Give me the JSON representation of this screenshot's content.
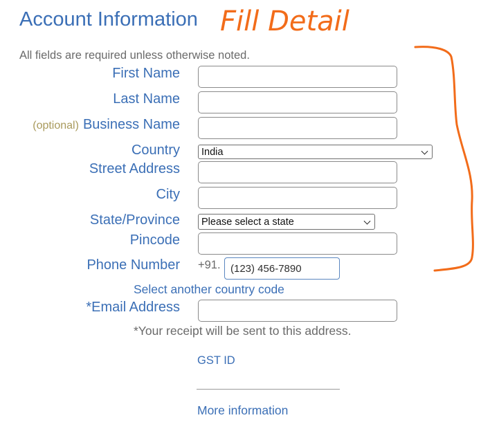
{
  "header": {
    "title": "Account Information",
    "required_note": "All fields are required unless otherwise noted."
  },
  "form": {
    "first_name": {
      "label": "First Name",
      "value": ""
    },
    "last_name": {
      "label": "Last Name",
      "value": ""
    },
    "business_name": {
      "optional_tag": "(optional)",
      "label": "Business Name",
      "value": ""
    },
    "country": {
      "label": "Country",
      "selected": "India"
    },
    "street_address": {
      "label": "Street Address",
      "value": ""
    },
    "city": {
      "label": "City",
      "value": ""
    },
    "state": {
      "label": "State/Province",
      "selected": "Please select a state"
    },
    "pincode": {
      "label": "Pincode",
      "value": ""
    },
    "phone": {
      "label": "Phone Number",
      "prefix": "+91.",
      "placeholder": "(123) 456-7890",
      "change_country_link": "Select another country code"
    },
    "email": {
      "label": "*Email Address",
      "value": "",
      "note": "*Your receipt will be sent to this address."
    },
    "gst": {
      "label": "GST ID",
      "more_info_link": "More information"
    }
  },
  "annotation": {
    "handwritten_text": "Fill Detail",
    "color": "#f26c1a"
  },
  "colors": {
    "label_blue": "#3b6fb6",
    "muted_gray": "#6a6a6a",
    "optional_olive": "#a99a5c"
  }
}
